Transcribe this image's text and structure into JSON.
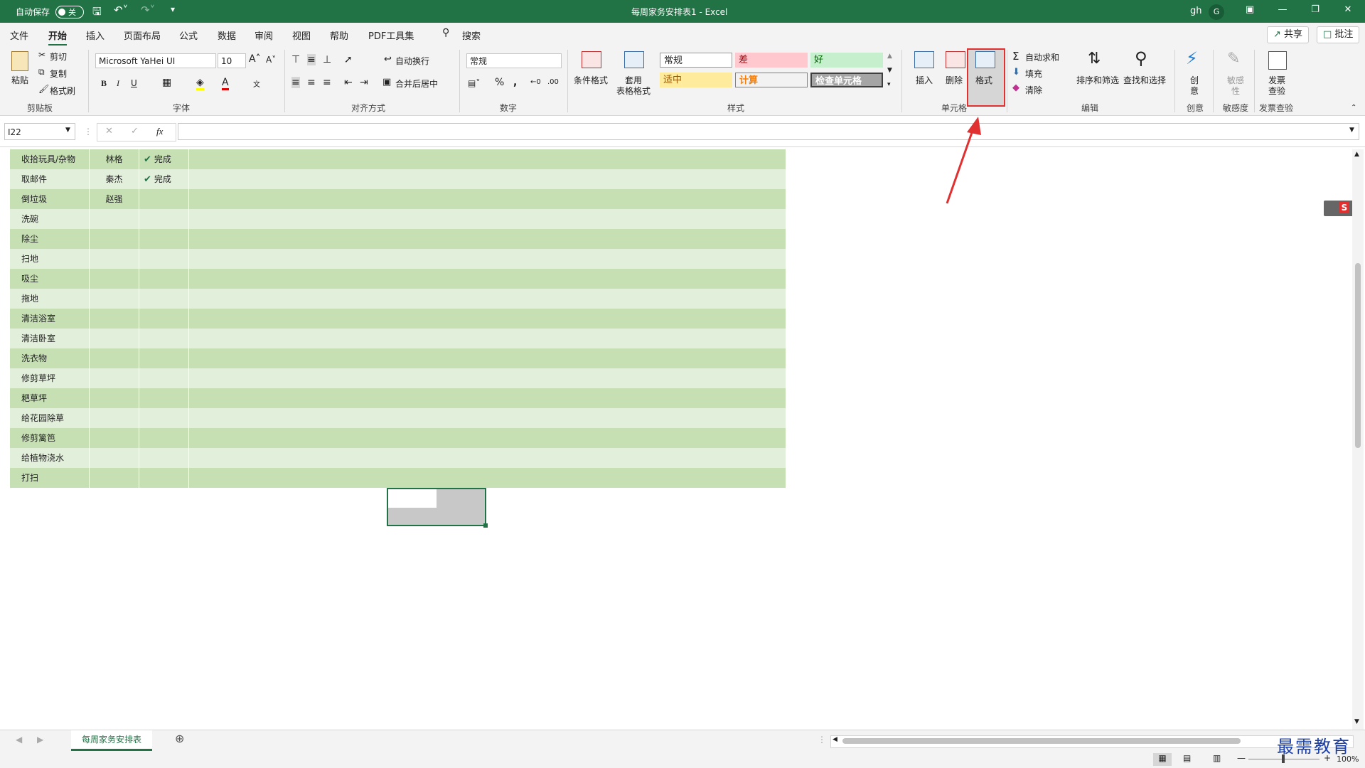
{
  "titlebar": {
    "autosave_label": "自动保存",
    "autosave_state": "关",
    "doc_title": "每周家务安排表1  -  Excel",
    "user": "gh",
    "avatar_letter": "G"
  },
  "menu": {
    "tabs": [
      "文件",
      "开始",
      "插入",
      "页面布局",
      "公式",
      "数据",
      "审阅",
      "视图",
      "帮助",
      "PDF工具集"
    ],
    "active": "开始",
    "search": "搜索",
    "share": "共享",
    "comments": "批注"
  },
  "ribbon": {
    "paste": "粘贴",
    "cut": "剪切",
    "copy": "复制",
    "format_painter": "格式刷",
    "group_clipboard": "剪贴板",
    "font_name": "Microsoft YaHei UI",
    "font_size": "10",
    "group_font": "字体",
    "wrap_text": "自动换行",
    "merge_center": "合并后居中",
    "group_alignment": "对齐方式",
    "number_format": "常规",
    "group_number": "数字",
    "conditional_format": "条件格式",
    "table_format_1": "套用",
    "table_format_2": "表格格式",
    "styles": {
      "normal": "常规",
      "bad": "差",
      "good": "好",
      "neutral": "适中",
      "calculation": "计算",
      "check_cell": "检查单元格"
    },
    "group_styles": "样式",
    "insert": "插入",
    "delete": "删除",
    "format": "格式",
    "group_cells": "单元格",
    "autosum": "自动求和",
    "fill": "填充",
    "clear": "清除",
    "sort_filter": "排序和筛选",
    "find_select": "查找和选择",
    "group_editing": "编辑",
    "ideas_1": "创",
    "ideas_2": "意",
    "group_ideas": "创意",
    "sensitivity_1": "敏感",
    "sensitivity_2": "性",
    "group_sensitivity": "敏感度",
    "invoice_1": "发票",
    "invoice_2": "查验",
    "group_invoice": "发票查验"
  },
  "formula_bar": {
    "name_box": "I22",
    "fx": "fx",
    "content": ""
  },
  "grid": {
    "rows": [
      {
        "task": "收拾玩具/杂物",
        "person": "林格",
        "status": "完成"
      },
      {
        "task": "取邮件",
        "person": "秦杰",
        "status": "完成"
      },
      {
        "task": "倒垃圾",
        "person": "赵强",
        "status": ""
      },
      {
        "task": "洗碗",
        "person": "",
        "status": ""
      },
      {
        "task": "除尘",
        "person": "",
        "status": ""
      },
      {
        "task": "扫地",
        "person": "",
        "status": ""
      },
      {
        "task": "吸尘",
        "person": "",
        "status": ""
      },
      {
        "task": "拖地",
        "person": "",
        "status": ""
      },
      {
        "task": "清洁浴室",
        "person": "",
        "status": ""
      },
      {
        "task": "清洁卧室",
        "person": "",
        "status": ""
      },
      {
        "task": "洗衣物",
        "person": "",
        "status": ""
      },
      {
        "task": "修剪草坪",
        "person": "",
        "status": ""
      },
      {
        "task": "耙草坪",
        "person": "",
        "status": ""
      },
      {
        "task": "给花园除草",
        "person": "",
        "status": ""
      },
      {
        "task": "修剪篱笆",
        "person": "",
        "status": ""
      },
      {
        "task": "给植物浇水",
        "person": "",
        "status": ""
      },
      {
        "task": "打扫",
        "person": "",
        "status": ""
      }
    ]
  },
  "sheets": {
    "active": "每周家务安排表"
  },
  "status": {
    "zoom": "100%"
  },
  "watermark": "最需教育",
  "colors": {
    "excel_green": "#217346",
    "row_dark": "#c6e0b4",
    "row_light": "#e2efda",
    "highlight": "#e03030"
  }
}
